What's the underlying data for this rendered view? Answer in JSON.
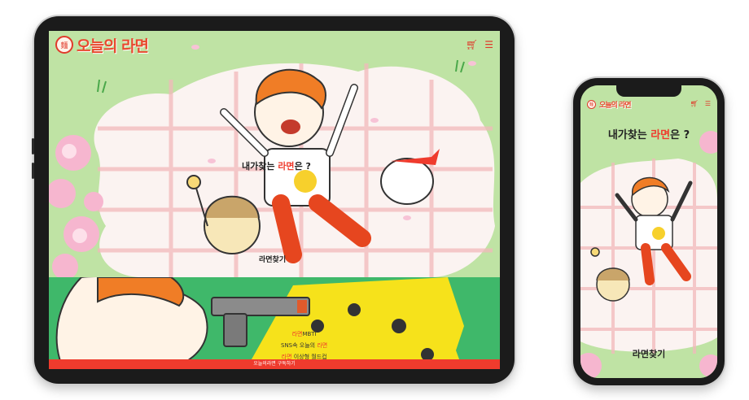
{
  "brand": {
    "logo_text": "오늘의 라면",
    "badge_glyph": "麵"
  },
  "header": {
    "cart_icon": "cart-icon",
    "menu_icon": "hamburger-menu-icon"
  },
  "hero": {
    "title_prefix": "내가찾는 ",
    "title_accent": "라면",
    "title_suffix": "은 ?",
    "find_label": "라면찾기"
  },
  "promo": {
    "line1_accent": "라면",
    "line1_rest": "MBTI",
    "line2_prefix": "SNS속 오늘의 ",
    "line2_accent": "라면",
    "line3_accent": "라면",
    "line3_rest": " 이상형 월드컵"
  },
  "footer": {
    "subscribe_label": "오늘의라면 구독하기"
  },
  "colors": {
    "accent": "#ef3b2d",
    "grass": "#bfe3a4",
    "promo_green": "#3fb86a",
    "promo_yellow": "#f6e21b"
  }
}
